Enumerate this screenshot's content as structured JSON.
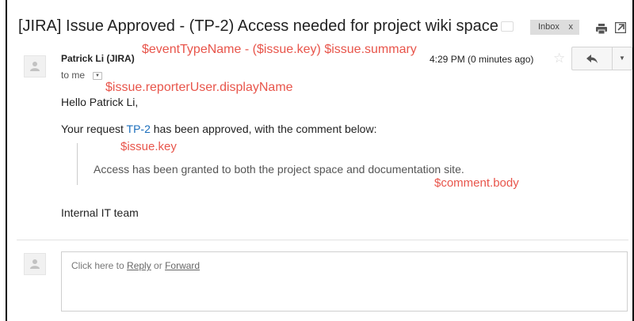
{
  "email": {
    "subject": "[JIRA] Issue Approved - (TP-2) Access needed for project wiki space",
    "inbox_label": "Inbox",
    "inbox_close": "x",
    "sender": "Patrick Li (JIRA)",
    "time": "4:29 PM (0 minutes ago)",
    "to": "to me",
    "greeting": "Hello Patrick Li,",
    "request_prefix": "Your request ",
    "issue_link": "TP-2",
    "request_suffix": " has been approved, with the comment below:",
    "quote": "Access has been granted to both the project space and documentation site.",
    "signoff": "Internal IT team"
  },
  "annotations": {
    "event": "$eventTypeName - ($issue.key) $issue.summary",
    "reporter": "$issue.reporterUser.displayName",
    "key": "$issue.key",
    "comment": "$comment.body"
  },
  "reply": {
    "prefix": "Click here to ",
    "reply": "Reply",
    "or": " or ",
    "forward": "Forward"
  },
  "colors": {
    "annotation": "#e8554b",
    "link": "#1a6dbb"
  }
}
